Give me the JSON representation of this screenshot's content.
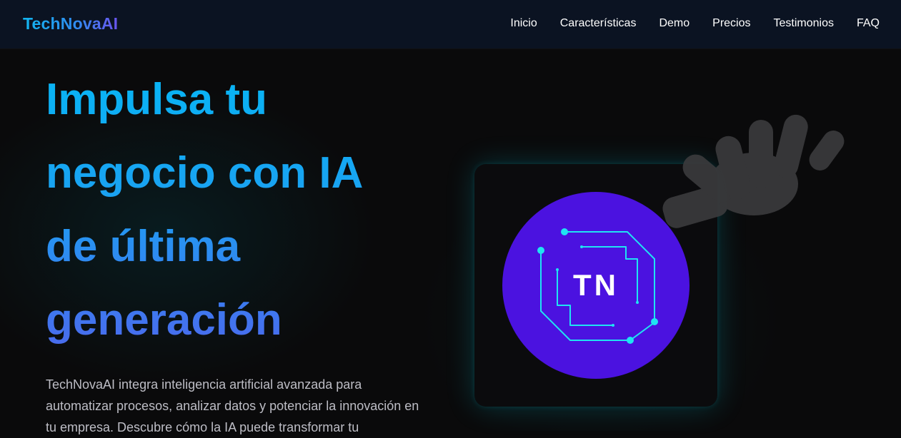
{
  "header": {
    "brand": "TechNovaAI",
    "nav": [
      "Inicio",
      "Características",
      "Demo",
      "Precios",
      "Testimonios",
      "FAQ"
    ]
  },
  "hero": {
    "title_lines": [
      "Impulsa tu",
      "negocio con",
      "IA",
      "de última",
      "generación"
    ],
    "description": "TechNovaAI integra inteligencia artificial avanzada para automatizar procesos, analizar datos y potenciar la innovación en tu empresa. Descubre cómo la IA puede transformar tu"
  },
  "logo": {
    "monogram": "TN",
    "circle_color": "#4b12e0",
    "circuit_color": "#1fe4f2",
    "icon": "circuit-board-icon"
  },
  "decor": {
    "hand_icon": "robot-hand-icon"
  },
  "colors": {
    "background": "#0a0a0b",
    "header_bg": "#0b1322",
    "accent_cyan": "#06b6f5",
    "accent_blue": "#3b7cf0",
    "accent_violet": "#6a55ee",
    "text_muted": "#bdbdc5"
  }
}
